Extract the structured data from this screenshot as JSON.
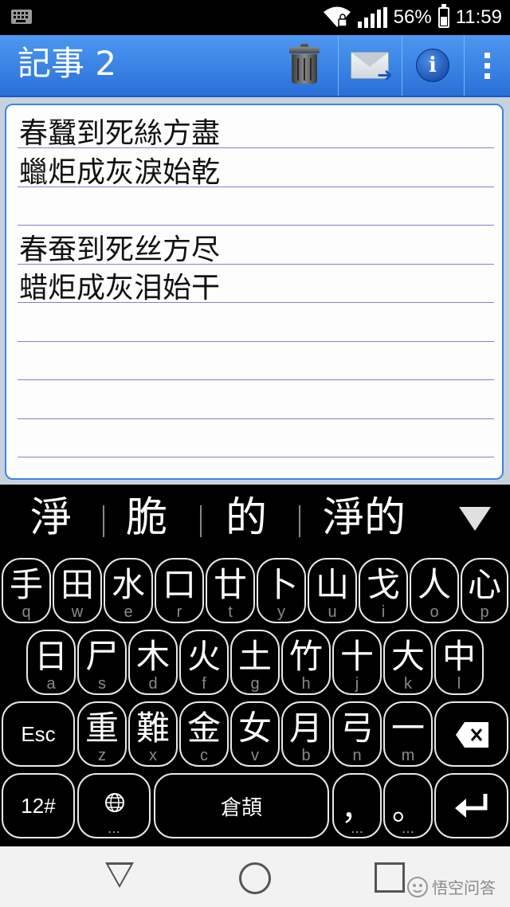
{
  "status_bar": {
    "battery": "56%",
    "time": "11:59",
    "battery_level": 0.56
  },
  "titlebar": {
    "title": "記事 2",
    "actions": [
      {
        "name": "delete",
        "icon": "trash-icon"
      },
      {
        "name": "send",
        "icon": "mail-icon"
      },
      {
        "name": "info",
        "icon": "info-icon",
        "glyph": "i"
      },
      {
        "name": "more",
        "icon": "overflow-icon"
      }
    ]
  },
  "note": {
    "lines": [
      "春蠶到死絲方盡",
      "蠟炬成灰淚始乾",
      "",
      "春蚕到死丝方尽",
      "蜡炬成灰泪始干"
    ]
  },
  "candidates": {
    "items": [
      "淨",
      "脆",
      "的",
      "淨的"
    ]
  },
  "keyboard": {
    "row1": [
      {
        "main": "手",
        "sub": "q"
      },
      {
        "main": "田",
        "sub": "w"
      },
      {
        "main": "水",
        "sub": "e"
      },
      {
        "main": "口",
        "sub": "r"
      },
      {
        "main": "廿",
        "sub": "t"
      },
      {
        "main": "卜",
        "sub": "y"
      },
      {
        "main": "山",
        "sub": "u"
      },
      {
        "main": "戈",
        "sub": "i"
      },
      {
        "main": "人",
        "sub": "o"
      },
      {
        "main": "心",
        "sub": "p"
      }
    ],
    "row2": [
      {
        "main": "日",
        "sub": "a"
      },
      {
        "main": "尸",
        "sub": "s"
      },
      {
        "main": "木",
        "sub": "d"
      },
      {
        "main": "火",
        "sub": "f"
      },
      {
        "main": "土",
        "sub": "g"
      },
      {
        "main": "竹",
        "sub": "h"
      },
      {
        "main": "十",
        "sub": "j"
      },
      {
        "main": "大",
        "sub": "k"
      },
      {
        "main": "中",
        "sub": "l"
      }
    ],
    "row3": {
      "esc": "Esc",
      "keys": [
        {
          "main": "重",
          "sub": "z"
        },
        {
          "main": "難",
          "sub": "x"
        },
        {
          "main": "金",
          "sub": "c"
        },
        {
          "main": "女",
          "sub": "v"
        },
        {
          "main": "月",
          "sub": "b"
        },
        {
          "main": "弓",
          "sub": "n"
        },
        {
          "main": "一",
          "sub": "m"
        }
      ]
    },
    "row4": {
      "symbols": "12#",
      "space": "倉頡",
      "comma": "，",
      "period": "。",
      "dots": "…"
    }
  },
  "watermark": "悟空问答",
  "colors": {
    "title_bar": "#3a86ea",
    "note_border": "#3b85e6",
    "rule_line": "#7e82d8",
    "keyboard_bg": "#000000"
  }
}
